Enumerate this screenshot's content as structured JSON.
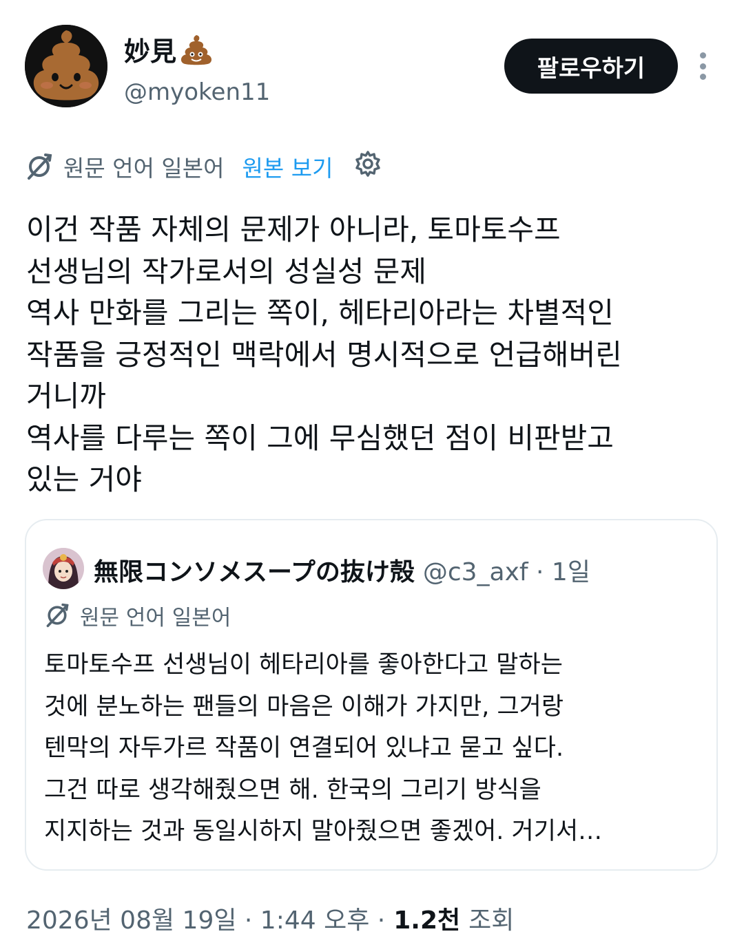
{
  "author": {
    "display_name": "妙見",
    "name_emoji": "pile-of-poo-emoji",
    "handle": "@myoken11",
    "avatar": "poop-face-avatar"
  },
  "header": {
    "follow_label": "팔로우하기",
    "more_icon": "more-vertical-icon"
  },
  "translation": {
    "source_language": "원문 언어 일본어",
    "show_original": "원본 보기",
    "translate_icon": "translate-icon",
    "settings_icon": "gear-icon",
    "accent_color": "#1d9bf0"
  },
  "tweet": {
    "lines": [
      "이건 작품 자체의 문제가 아니라, 토마토수프",
      "선생님의 작가로서의 성실성 문제",
      "역사 만화를 그리는 쪽이, 헤타리아라는 차별적인",
      "작품을 긍정적인 맥락에서 명시적으로 언급해버린",
      "거니까",
      "역사를 다루는 쪽이 그에 무심했던 점이 비판받고",
      "있는 거야"
    ]
  },
  "quote": {
    "display_name": "無限コンソメスープの抜け殻",
    "handle_time": "@c3_axf · 1일",
    "source_language": "원문 언어 일본어",
    "avatar": "anime-character-avatar",
    "lines": [
      "토마토수프 선생님이 헤타리아를 좋아한다고 말하는",
      "것에 분노하는 팬들의 마음은 이해가 가지만, 그거랑",
      "텐막의 자두가르 작품이 연결되어 있냐고 묻고 싶다.",
      "그건 따로 생각해줬으면 해. 한국의 그리기 방식을",
      "지지하는 것과 동일시하지 말아줬으면 좋겠어. 거기서…"
    ]
  },
  "meta": {
    "timestamp": "2026년 08월 19일 · 1:44 오후 ·",
    "views_count": "1.2천",
    "views_label": "조회"
  }
}
